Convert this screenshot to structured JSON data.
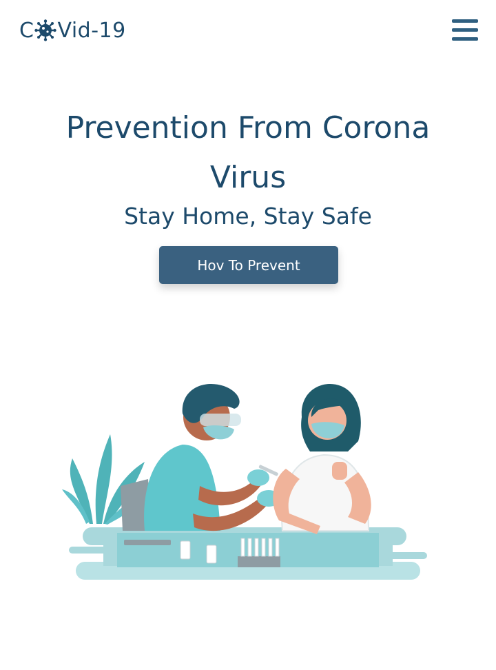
{
  "header": {
    "logo_prefix": "C",
    "logo_suffix": "Vid-19",
    "logo_icon": "virus-icon",
    "menu_icon": "hamburger-menu-icon"
  },
  "hero": {
    "title_line1": "Prevention From Corona",
    "title_line2": "Virus",
    "subtitle": "Stay Home, Stay Safe",
    "cta_label": "Hov To Prevent"
  },
  "illustration": {
    "icon": "vaccination-illustration"
  },
  "colors": {
    "primary_text": "#1d4a6b",
    "button_bg": "#3a6180",
    "button_text": "#ffffff",
    "teal": "#5fc0c8",
    "background": "#ffffff"
  }
}
